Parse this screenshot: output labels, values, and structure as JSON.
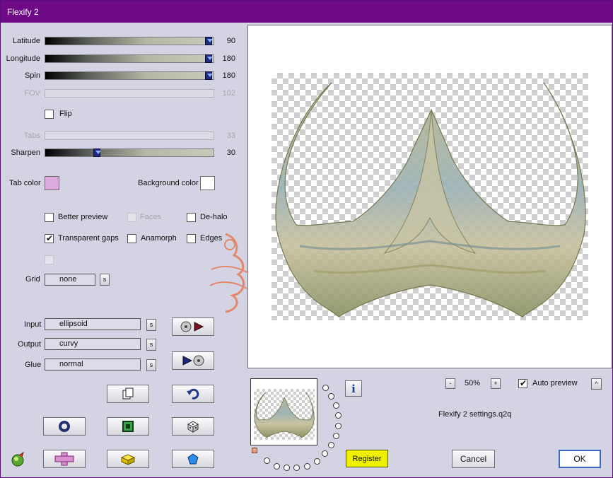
{
  "window": {
    "title": "Flexify 2"
  },
  "sliders": [
    {
      "label": "Latitude",
      "value": "90",
      "fraction": 1.0,
      "enabled": true
    },
    {
      "label": "Longitude",
      "value": "180",
      "fraction": 1.0,
      "enabled": true
    },
    {
      "label": "Spin",
      "value": "180",
      "fraction": 1.0,
      "enabled": true
    },
    {
      "label": "FOV",
      "value": "102",
      "fraction": 0.0,
      "enabled": false
    },
    {
      "label": "Tabs",
      "value": "33",
      "fraction": 0.0,
      "enabled": false
    },
    {
      "label": "Sharpen",
      "value": "30",
      "fraction": 0.3,
      "enabled": true
    }
  ],
  "flip": {
    "label": "Flip",
    "checked": false
  },
  "colors": {
    "tab_color_label": "Tab color",
    "tab_color": "#dcaadf",
    "background_color_label": "Background color",
    "background_color": "#ffffff",
    "accent_title": "#6e0a86",
    "register_yellow": "#efef00"
  },
  "options": {
    "better_preview": {
      "label": "Better preview",
      "checked": false
    },
    "faces": {
      "label": "Faces",
      "checked": false
    },
    "de_halo": {
      "label": "De-halo",
      "checked": false
    },
    "transparent_gaps": {
      "label": "Transparent gaps",
      "checked": true
    },
    "anamorph": {
      "label": "Anamorph",
      "checked": false
    },
    "edges": {
      "label": "Edges",
      "checked": false
    }
  },
  "grid": {
    "label": "Grid",
    "value": "none",
    "s": "s"
  },
  "projection": {
    "input_label": "Input",
    "input_value": "ellipsoid",
    "output_label": "Output",
    "output_value": "curvy",
    "glue_label": "Glue",
    "glue_value": "normal",
    "s": "s"
  },
  "zoom": {
    "minus": "-",
    "value": "50%",
    "plus": "+"
  },
  "auto_preview": {
    "label": "Auto preview",
    "checked": true,
    "caret": "^"
  },
  "settings_file": "Flexify 2 settings.q2q",
  "info": "i",
  "buttons": {
    "register": "Register",
    "cancel": "Cancel",
    "ok": "OK"
  },
  "icons": {
    "forward": "play-forward-icon",
    "backward": "play-backward-icon",
    "copy": "copy-page-icon",
    "undo": "undo-arrow-icon",
    "ring": "ring-icon",
    "square": "square-frame-icon",
    "dice": "dice-icon",
    "plus": "pink-cross-icon",
    "cube": "yellow-cube-icon",
    "pentagon": "blue-pentagon-icon",
    "plugin": "plugin-logo-icon"
  }
}
